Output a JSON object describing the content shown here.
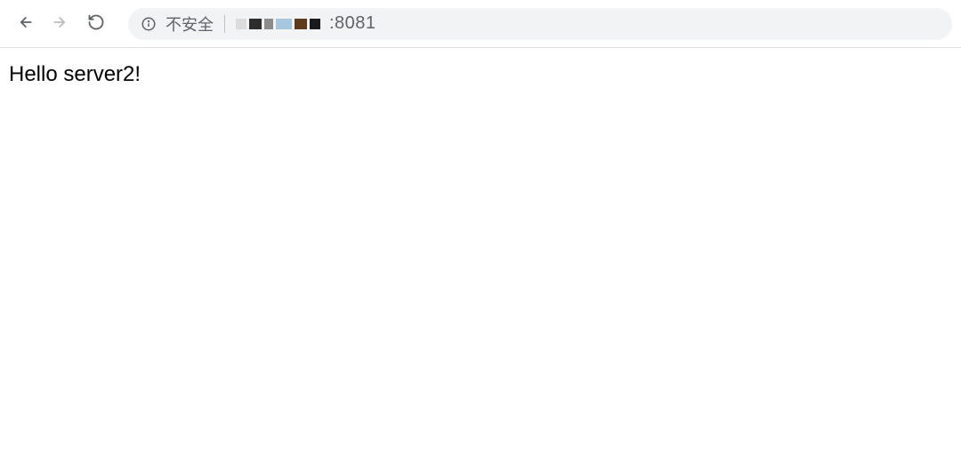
{
  "toolbar": {
    "security_label": "不安全",
    "url_suffix": ":8081"
  },
  "page": {
    "body_text": "Hello server2!"
  }
}
